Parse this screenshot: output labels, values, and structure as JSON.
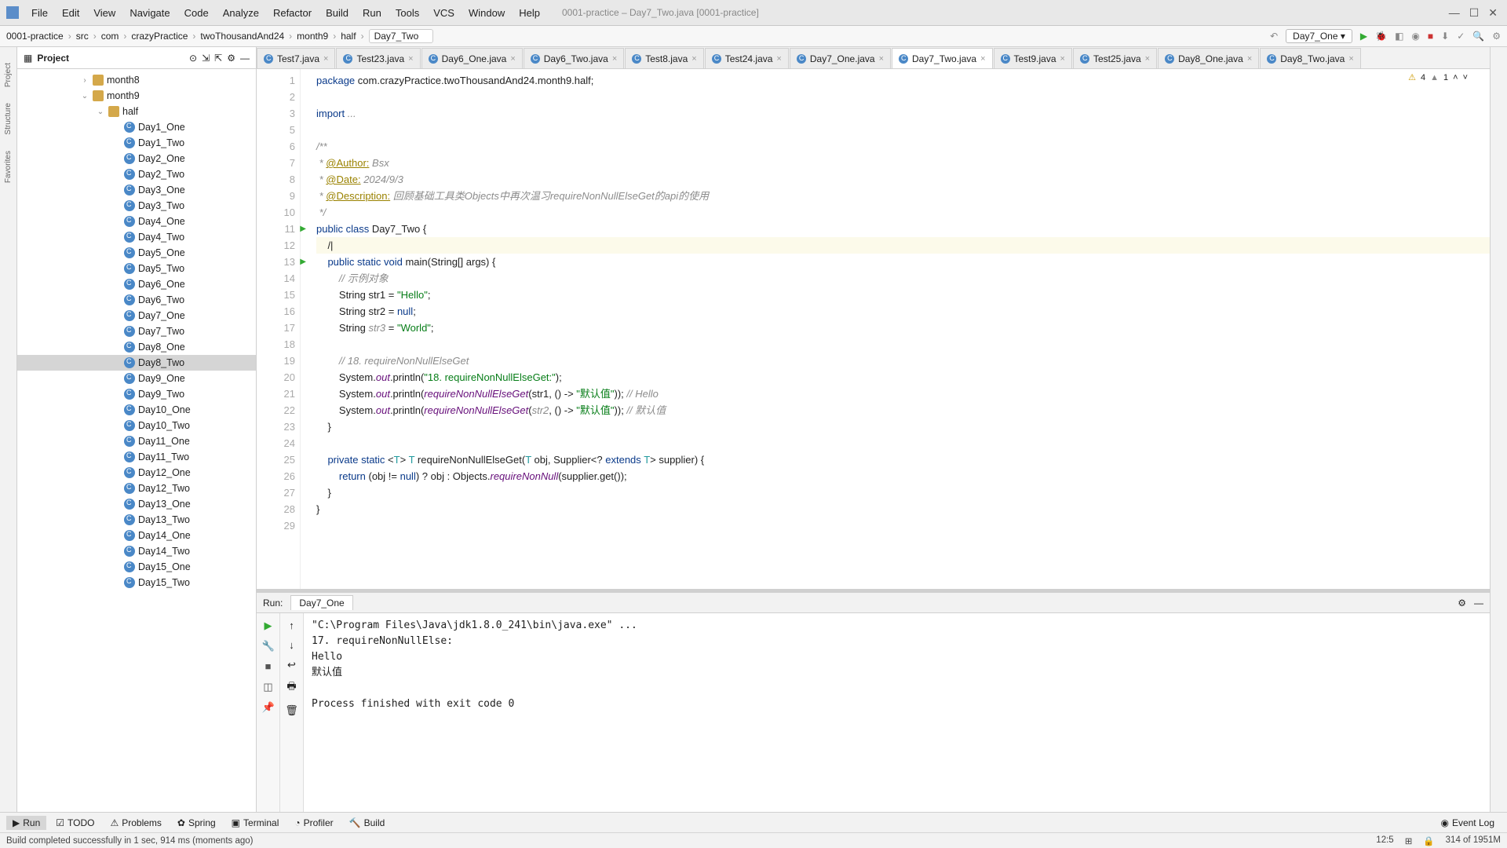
{
  "menu": {
    "file": "File",
    "edit": "Edit",
    "view": "View",
    "navigate": "Navigate",
    "code": "Code",
    "analyze": "Analyze",
    "refactor": "Refactor",
    "build": "Build",
    "run": "Run",
    "tools": "Tools",
    "vcs": "VCS",
    "window": "Window",
    "help": "Help"
  },
  "window_title": "0001-practice – Day7_Two.java [0001-practice]",
  "breadcrumbs": [
    "0001-practice",
    "src",
    "com",
    "crazyPractice",
    "twoThousandAnd24",
    "month9",
    "half",
    "Day7_Two"
  ],
  "run_config": "Day7_One",
  "project": {
    "label": "Project",
    "nodes": [
      {
        "indent": 1,
        "arrow": "›",
        "icon": "folder",
        "label": "month8"
      },
      {
        "indent": 1,
        "arrow": "⌄",
        "icon": "folder",
        "label": "month9"
      },
      {
        "indent": 2,
        "arrow": "⌄",
        "icon": "folder",
        "label": "half"
      },
      {
        "indent": 3,
        "arrow": "",
        "icon": "class",
        "label": "Day1_One"
      },
      {
        "indent": 3,
        "arrow": "",
        "icon": "class",
        "label": "Day1_Two"
      },
      {
        "indent": 3,
        "arrow": "",
        "icon": "class",
        "label": "Day2_One"
      },
      {
        "indent": 3,
        "arrow": "",
        "icon": "class",
        "label": "Day2_Two"
      },
      {
        "indent": 3,
        "arrow": "",
        "icon": "class",
        "label": "Day3_One"
      },
      {
        "indent": 3,
        "arrow": "",
        "icon": "class",
        "label": "Day3_Two"
      },
      {
        "indent": 3,
        "arrow": "",
        "icon": "class",
        "label": "Day4_One"
      },
      {
        "indent": 3,
        "arrow": "",
        "icon": "class",
        "label": "Day4_Two"
      },
      {
        "indent": 3,
        "arrow": "",
        "icon": "class",
        "label": "Day5_One"
      },
      {
        "indent": 3,
        "arrow": "",
        "icon": "class",
        "label": "Day5_Two"
      },
      {
        "indent": 3,
        "arrow": "",
        "icon": "class",
        "label": "Day6_One"
      },
      {
        "indent": 3,
        "arrow": "",
        "icon": "class",
        "label": "Day6_Two"
      },
      {
        "indent": 3,
        "arrow": "",
        "icon": "class",
        "label": "Day7_One"
      },
      {
        "indent": 3,
        "arrow": "",
        "icon": "class",
        "label": "Day7_Two"
      },
      {
        "indent": 3,
        "arrow": "",
        "icon": "class",
        "label": "Day8_One"
      },
      {
        "indent": 3,
        "arrow": "",
        "icon": "class",
        "label": "Day8_Two",
        "selected": true
      },
      {
        "indent": 3,
        "arrow": "",
        "icon": "class",
        "label": "Day9_One"
      },
      {
        "indent": 3,
        "arrow": "",
        "icon": "class",
        "label": "Day9_Two"
      },
      {
        "indent": 3,
        "arrow": "",
        "icon": "class",
        "label": "Day10_One"
      },
      {
        "indent": 3,
        "arrow": "",
        "icon": "class",
        "label": "Day10_Two"
      },
      {
        "indent": 3,
        "arrow": "",
        "icon": "class",
        "label": "Day11_One"
      },
      {
        "indent": 3,
        "arrow": "",
        "icon": "class",
        "label": "Day11_Two"
      },
      {
        "indent": 3,
        "arrow": "",
        "icon": "class",
        "label": "Day12_One"
      },
      {
        "indent": 3,
        "arrow": "",
        "icon": "class",
        "label": "Day12_Two"
      },
      {
        "indent": 3,
        "arrow": "",
        "icon": "class",
        "label": "Day13_One"
      },
      {
        "indent": 3,
        "arrow": "",
        "icon": "class",
        "label": "Day13_Two"
      },
      {
        "indent": 3,
        "arrow": "",
        "icon": "class",
        "label": "Day14_One"
      },
      {
        "indent": 3,
        "arrow": "",
        "icon": "class",
        "label": "Day14_Two"
      },
      {
        "indent": 3,
        "arrow": "",
        "icon": "class",
        "label": "Day15_One"
      },
      {
        "indent": 3,
        "arrow": "",
        "icon": "class",
        "label": "Day15_Two"
      }
    ]
  },
  "editor_tabs": [
    {
      "label": "Test7.java"
    },
    {
      "label": "Test23.java"
    },
    {
      "label": "Day6_One.java"
    },
    {
      "label": "Day6_Two.java"
    },
    {
      "label": "Test8.java"
    },
    {
      "label": "Test24.java"
    },
    {
      "label": "Day7_One.java"
    },
    {
      "label": "Day7_Two.java",
      "active": true
    },
    {
      "label": "Test9.java"
    },
    {
      "label": "Test25.java"
    },
    {
      "label": "Day8_One.java"
    },
    {
      "label": "Day8_Two.java"
    }
  ],
  "inspection": {
    "warnings": "4",
    "highlights": "1"
  },
  "code_lines": [
    {
      "n": 1,
      "html": "<span class='kw'>package</span> com.crazyPractice.twoThousandAnd24.month9.half;"
    },
    {
      "n": 2,
      "html": ""
    },
    {
      "n": 3,
      "html": "<span class='kw'>import</span> <span class='cmt'>...</span>"
    },
    {
      "n": 5,
      "html": ""
    },
    {
      "n": 6,
      "html": "<span class='cmt'>/**</span>"
    },
    {
      "n": 7,
      "html": "<span class='cmt'> * </span><span class='ann'>@Author:</span> <span class='cmt'>Bsx</span>"
    },
    {
      "n": 8,
      "html": "<span class='cmt'> * </span><span class='ann'>@Date:</span> <span class='cmt'>2024/9/3</span>"
    },
    {
      "n": 9,
      "html": "<span class='cmt'> * </span><span class='ann'>@Description:</span> <span class='cmt'>回顾基础工具类Objects中再次温习requireNonNullElseGet的api的使用</span>"
    },
    {
      "n": 10,
      "html": "<span class='cmt'> */</span>"
    },
    {
      "n": 11,
      "run": true,
      "html": "<span class='kw'>public class</span> Day7_Two {"
    },
    {
      "n": 12,
      "current": true,
      "html": "    /|"
    },
    {
      "n": 13,
      "run": true,
      "html": "    <span class='kw'>public static void</span> main(String[] args) {"
    },
    {
      "n": 14,
      "html": "        <span class='cmt'>// 示例对象</span>"
    },
    {
      "n": 15,
      "html": "        String str1 = <span class='str'>\"Hello\"</span>;"
    },
    {
      "n": 16,
      "html": "        String str2 = <span class='kw'>null</span>;"
    },
    {
      "n": 17,
      "html": "        String <span class='cmt'>str3</span> = <span class='str'>\"World\"</span>;"
    },
    {
      "n": 18,
      "html": ""
    },
    {
      "n": 19,
      "html": "        <span class='cmt'>// 18. requireNonNullElseGet</span>"
    },
    {
      "n": 20,
      "html": "        System.<span class='field'>out</span>.println(<span class='str'>\"18. requireNonNullElseGet:\"</span>);"
    },
    {
      "n": 21,
      "html": "        System.<span class='field'>out</span>.println(<span class='field'>requireNonNullElseGet</span>(str1, () -> <span class='str'>\"默认值\"</span>)); <span class='cmt'>// Hello</span>"
    },
    {
      "n": 22,
      "html": "        System.<span class='field'>out</span>.println(<span class='field'>requireNonNullElseGet</span>(<span class='cmt'>str2</span>, () -> <span class='str'>\"默认值\"</span>)); <span class='cmt'>// 默认值</span>"
    },
    {
      "n": 23,
      "html": "    }"
    },
    {
      "n": 24,
      "html": ""
    },
    {
      "n": 25,
      "html": "    <span class='kw'>private static</span> &lt;<span class='type'>T</span>&gt; <span class='type'>T</span> requireNonNullElseGet(<span class='type'>T</span> obj, Supplier&lt;? <span class='kw'>extends</span> <span class='type'>T</span>&gt; supplier) {"
    },
    {
      "n": 26,
      "html": "        <span class='kw'>return</span> (obj != <span class='kw'>null</span>) ? obj : Objects.<span class='field'>requireNonNull</span>(supplier.get());"
    },
    {
      "n": 27,
      "html": "    }"
    },
    {
      "n": 28,
      "html": "}"
    },
    {
      "n": 29,
      "html": ""
    }
  ],
  "run": {
    "label": "Run:",
    "config_tab": "Day7_One",
    "output": "\"C:\\Program Files\\Java\\jdk1.8.0_241\\bin\\java.exe\" ...\n17. requireNonNullElse:\nHello\n默认值\n\nProcess finished with exit code 0"
  },
  "bottom_tabs": {
    "run": "Run",
    "todo": "TODO",
    "problems": "Problems",
    "spring": "Spring",
    "terminal": "Terminal",
    "profiler": "Profiler",
    "build": "Build",
    "eventlog": "Event Log"
  },
  "status": {
    "msg": "Build completed successfully in 1 sec, 914 ms (moments ago)",
    "pos": "12:5",
    "mem": "314 of 1951M"
  },
  "sidetabs": {
    "project": "Project",
    "structure": "Structure",
    "favorites": "Favorites"
  }
}
